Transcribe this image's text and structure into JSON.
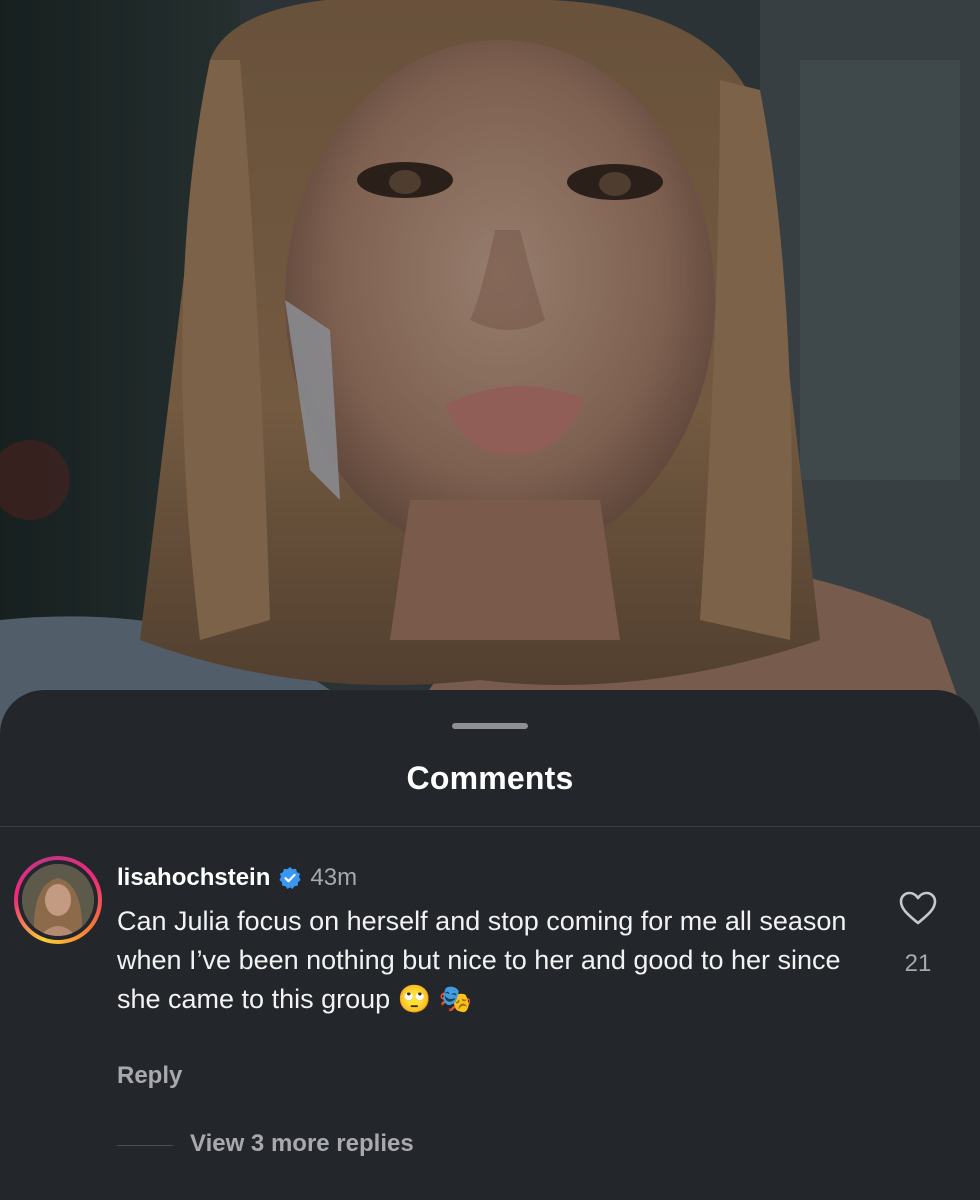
{
  "media": {
    "description_icon": "reality-tv-still"
  },
  "sheet": {
    "title": "Comments"
  },
  "comment": {
    "username": "lisahochstein",
    "verified_icon": "verified-badge-icon",
    "timestamp": "43m",
    "text": "Can Julia focus on herself and stop coming for me all season when I’ve been nothing but nice to her and good to her since she came to this group 🙄 🎭",
    "reply_label": "Reply",
    "like_icon": "heart-icon",
    "like_count": "21",
    "view_replies_label": "View 3 more replies"
  },
  "colors": {
    "sheet_bg": "#23262b",
    "verified_blue": "#3897f0",
    "secondary_text": "#a8a8ad"
  }
}
